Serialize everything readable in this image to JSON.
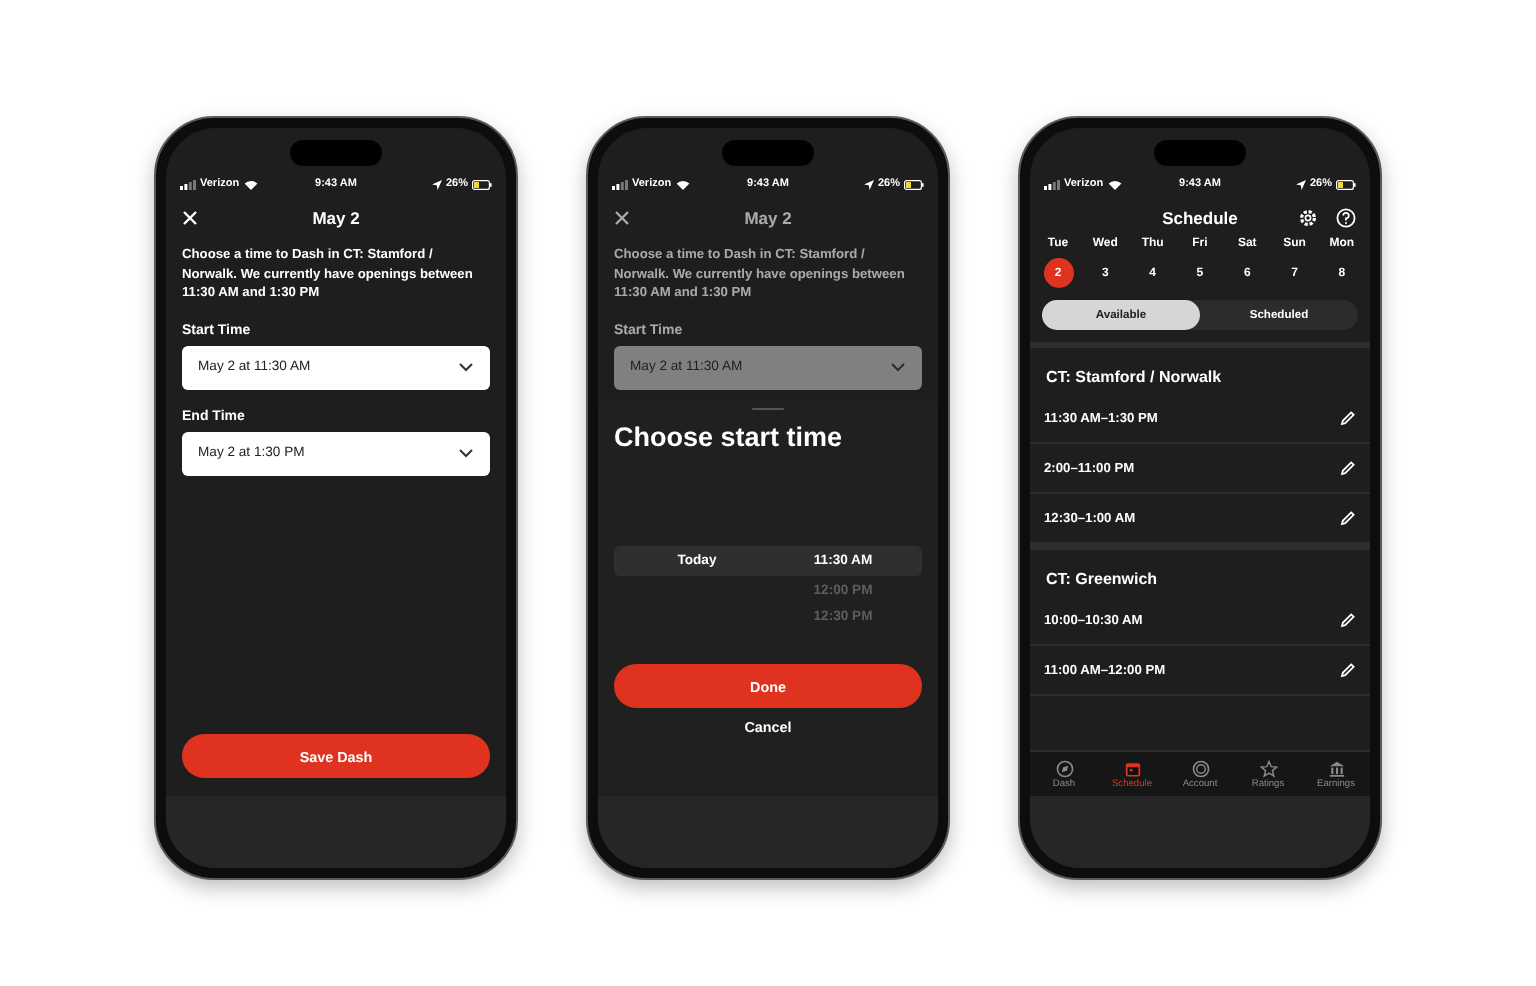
{
  "dash_form": {
    "status_bar": {
      "carrier": "Verizon",
      "time": "9:43 AM",
      "battery": "26%"
    },
    "title": "May 2",
    "description": "Choose a time to Dash in CT: Stamford / Norwalk. We currently have openings between 11:30 AM and 1:30 PM",
    "fields": [
      {
        "label": "Start Time",
        "value": "May 2 at 11:30 AM"
      },
      {
        "label": "End Time",
        "value": "May 2 at 1:30 PM"
      }
    ],
    "save_button": "Save Dash"
  },
  "start_time_picker": {
    "status_bar": {
      "carrier": "Verizon",
      "time": "9:43 AM",
      "battery": "26%"
    },
    "title": "May 2",
    "description": "Choose a time to Dash in CT: Stamford / Norwalk. We currently have openings between 11:30 AM and 1:30 PM",
    "fields": [
      {
        "label": "Start Time",
        "value": "May 2 at 11:30 AM"
      }
    ],
    "dimmed": true,
    "sheet": {
      "title": "Choose start time",
      "day": "Today",
      "times": [
        {
          "label": "11:30 AM",
          "selected": true
        },
        {
          "label": "12:00 PM",
          "selected": false
        },
        {
          "label": "12:30 PM",
          "selected": false
        }
      ],
      "done_button": "Done",
      "cancel_button": "Cancel"
    }
  },
  "schedule": {
    "status_bar": {
      "carrier": "Verizon",
      "time": "9:43 AM",
      "battery": "26%"
    },
    "title": "Schedule",
    "days": [
      {
        "weekday": "Tue",
        "date": "2",
        "selected": true
      },
      {
        "weekday": "Wed",
        "date": "3",
        "selected": false
      },
      {
        "weekday": "Thu",
        "date": "4",
        "selected": false
      },
      {
        "weekday": "Fri",
        "date": "5",
        "selected": false
      },
      {
        "weekday": "Sat",
        "date": "6",
        "selected": false
      },
      {
        "weekday": "Sun",
        "date": "7",
        "selected": false
      },
      {
        "weekday": "Mon",
        "date": "8",
        "selected": false
      }
    ],
    "segments": [
      {
        "label": "Available",
        "selected": true
      },
      {
        "label": "Scheduled",
        "selected": false
      }
    ],
    "sections": [
      {
        "name": "CT: Stamford / Norwalk",
        "slots": [
          "11:30 AM–1:30 PM",
          "2:00–11:00 PM",
          "12:30–1:00 AM"
        ]
      },
      {
        "name": "CT: Greenwich",
        "slots": [
          "10:00–10:30 AM",
          "11:00 AM–12:00 PM"
        ]
      }
    ],
    "tabs": [
      {
        "label": "Dash",
        "selected": false
      },
      {
        "label": "Schedule",
        "selected": true
      },
      {
        "label": "Account",
        "selected": false
      },
      {
        "label": "Ratings",
        "selected": false
      },
      {
        "label": "Earnings",
        "selected": false
      }
    ]
  }
}
